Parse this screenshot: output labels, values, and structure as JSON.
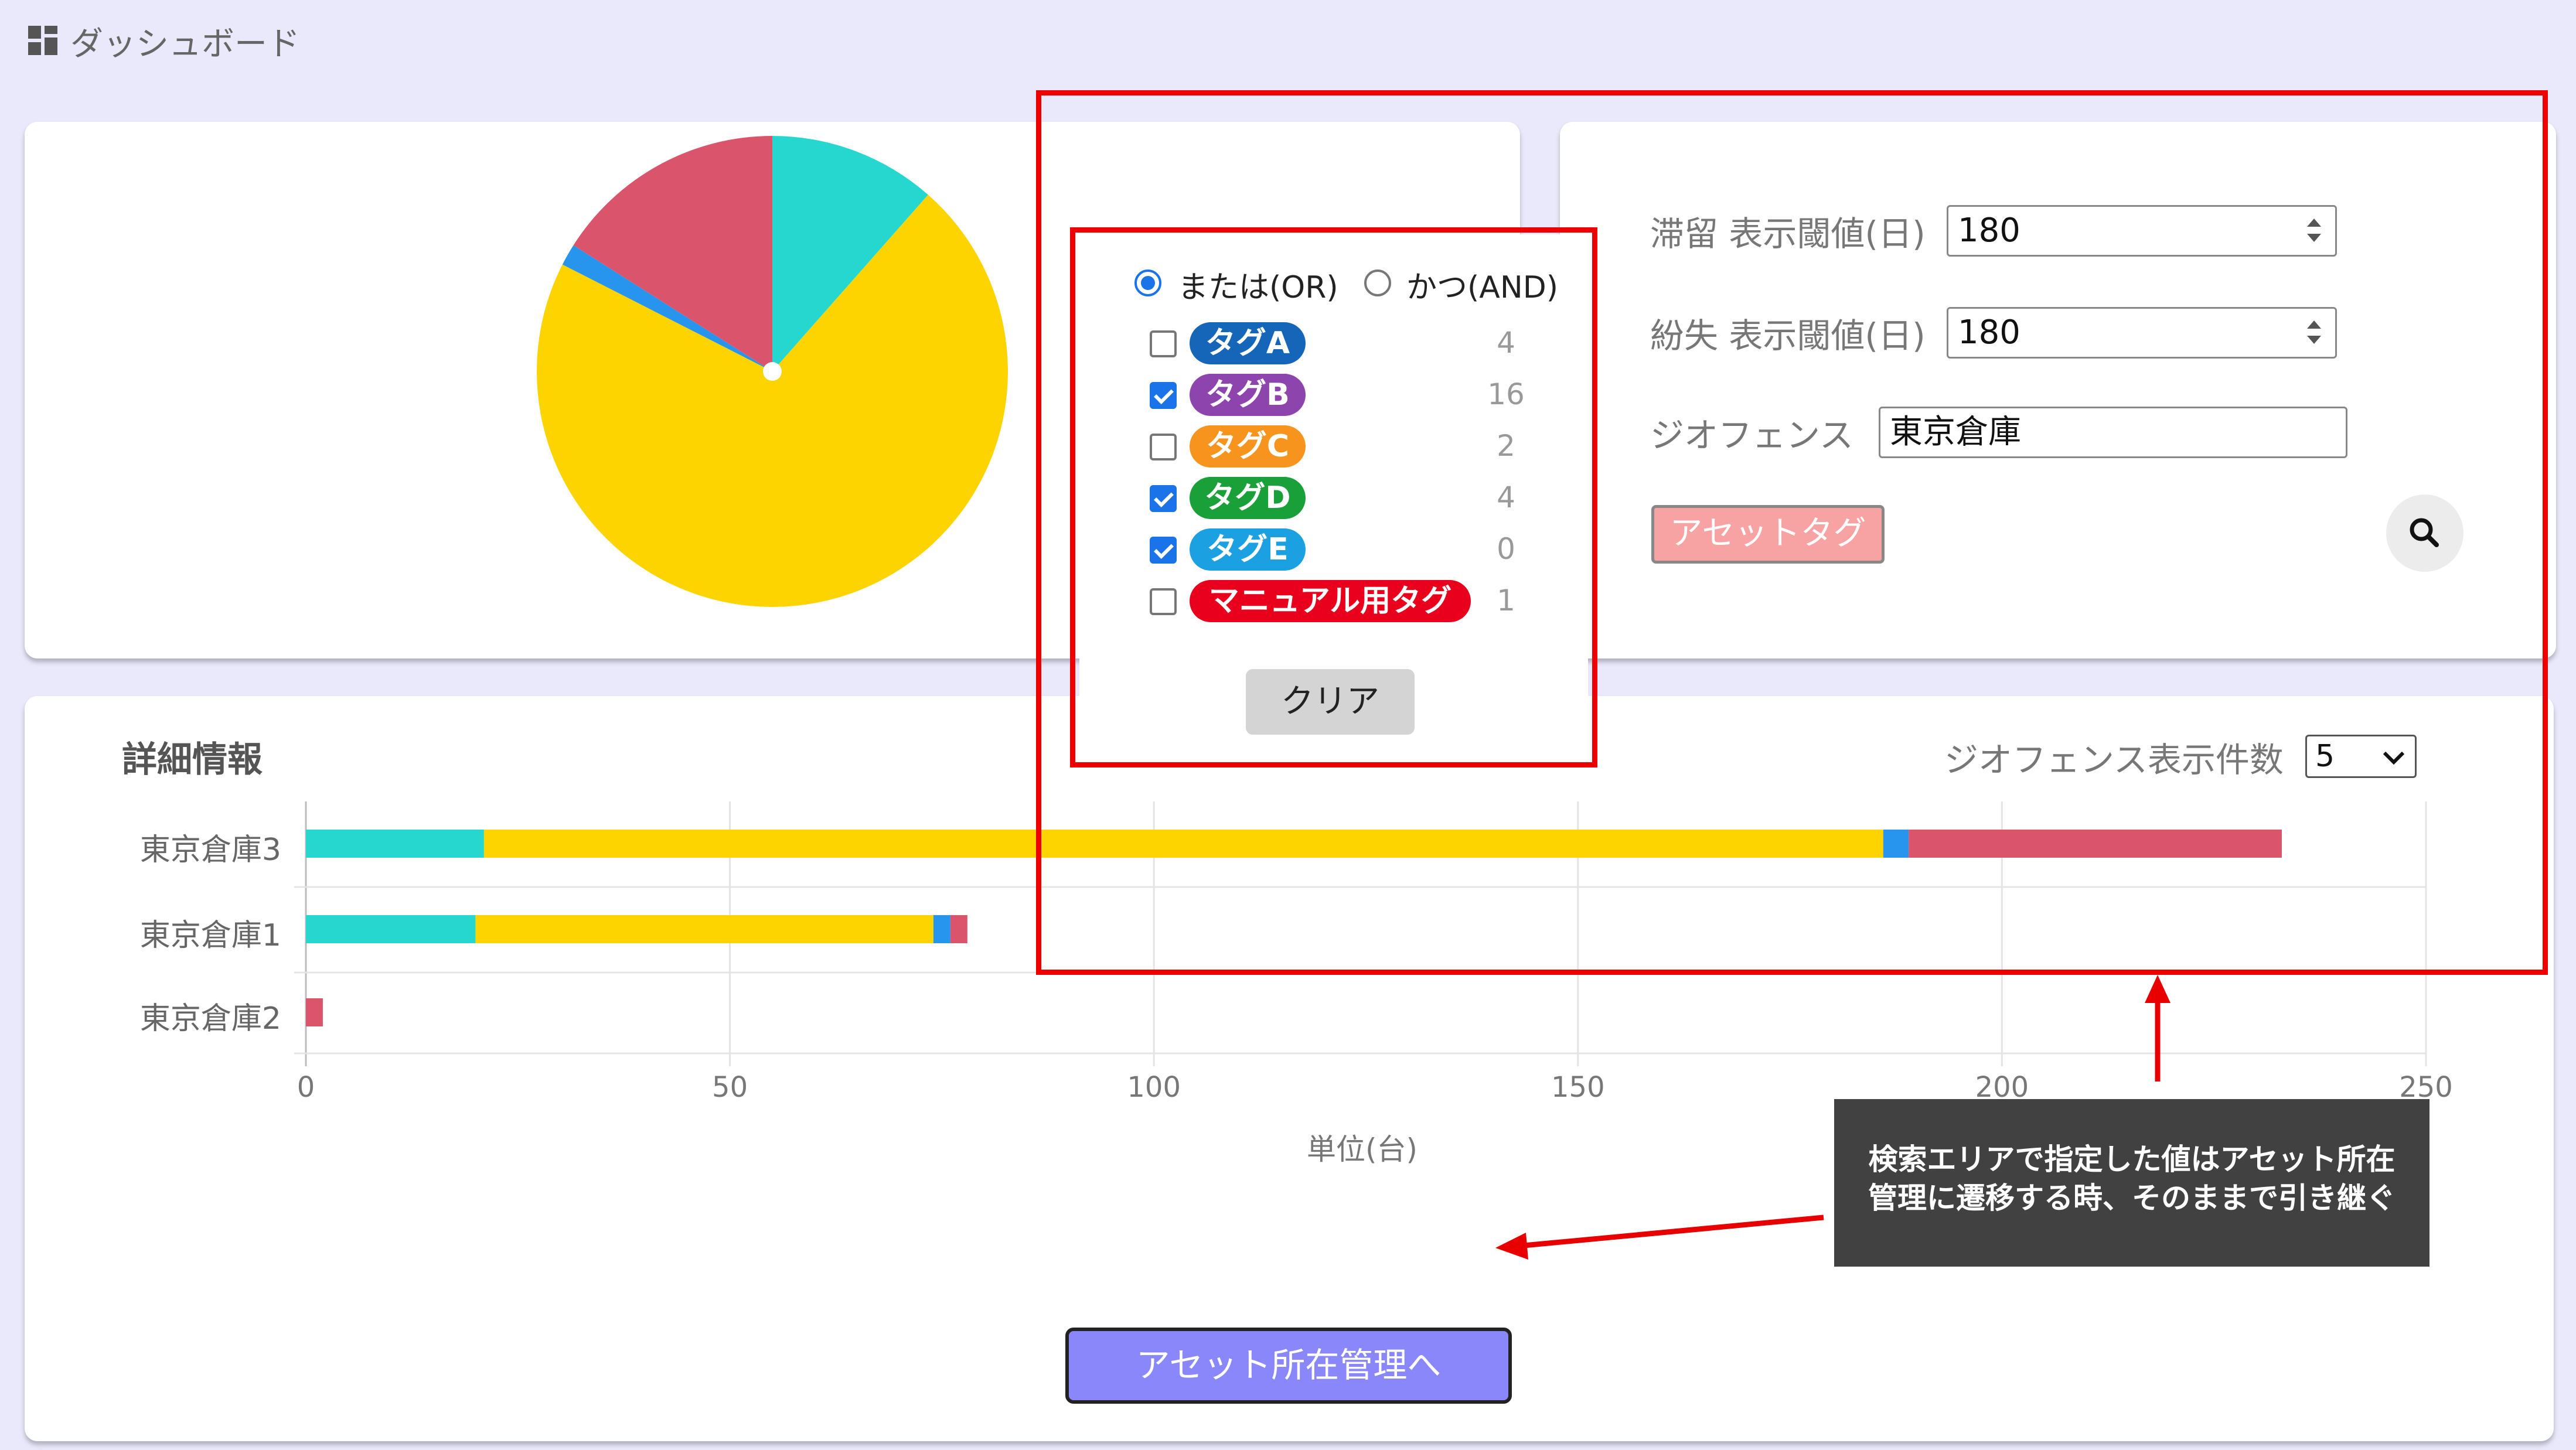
{
  "header": {
    "title": "ダッシュボード",
    "icon": "dashboard-icon"
  },
  "colors": {
    "teal": "#26d7cf",
    "yellow": "#fdd400",
    "blue": "#2795ee",
    "red": "#da556c"
  },
  "tag_filter": {
    "mode_or": "または(OR)",
    "mode_and": "かつ(AND)",
    "selected_mode": "or",
    "tags": [
      {
        "label": "タグA",
        "count": "4",
        "checked": false,
        "color": "#1566b8"
      },
      {
        "label": "タグB",
        "count": "16",
        "checked": true,
        "color": "#8e44ad"
      },
      {
        "label": "タグC",
        "count": "2",
        "checked": false,
        "color": "#f7941d"
      },
      {
        "label": "タグD",
        "count": "4",
        "checked": true,
        "color": "#1aa038"
      },
      {
        "label": "タグE",
        "count": "0",
        "checked": true,
        "color": "#1ba1e2"
      },
      {
        "label": "マニュアル用タグ",
        "count": "1",
        "checked": false,
        "color": "#e8001c"
      }
    ],
    "clear_button": "クリア"
  },
  "search": {
    "stay_label": "滞留 表示閾値(日)",
    "stay_value": "180",
    "lost_label": "紛失 表示閾値(日)",
    "lost_value": "180",
    "geofence_label": "ジオフェンス",
    "geofence_value": "東京倉庫",
    "asset_tag_button": "アセットタグ",
    "search_icon": "search-icon"
  },
  "details": {
    "title": "詳細情報",
    "geofence_count_label": "ジオフェンス表示件数",
    "geofence_count_value": "5",
    "unit_label": "単位(台)",
    "goto_button": "アセット所在管理へ"
  },
  "annotation": {
    "note": "検索エリアで指定した値はアセット所在管理に遷移する時、そのままで引き継ぐ"
  },
  "chart_data": [
    {
      "type": "pie",
      "slices": [
        {
          "color": "#26d7cf",
          "value": 11.5
        },
        {
          "color": "#fdd400",
          "value": 71
        },
        {
          "color": "#2795ee",
          "value": 1.5
        },
        {
          "color": "#da556c",
          "value": 16
        }
      ]
    },
    {
      "type": "bar",
      "orientation": "horizontal",
      "stacked": true,
      "categories": [
        "東京倉庫3",
        "東京倉庫1",
        "東京倉庫2"
      ],
      "series": [
        {
          "color": "#26d7cf",
          "values": [
            21,
            20,
            0
          ]
        },
        {
          "color": "#fdd400",
          "values": [
            165,
            54,
            0
          ]
        },
        {
          "color": "#2795ee",
          "values": [
            3,
            2,
            0
          ]
        },
        {
          "color": "#da556c",
          "values": [
            44,
            2,
            2
          ]
        }
      ],
      "xlim": [
        0,
        250
      ],
      "xticks": [
        "0",
        "50",
        "100",
        "150",
        "200",
        "250"
      ],
      "xlabel": "単位(台)",
      "grid": true
    }
  ]
}
